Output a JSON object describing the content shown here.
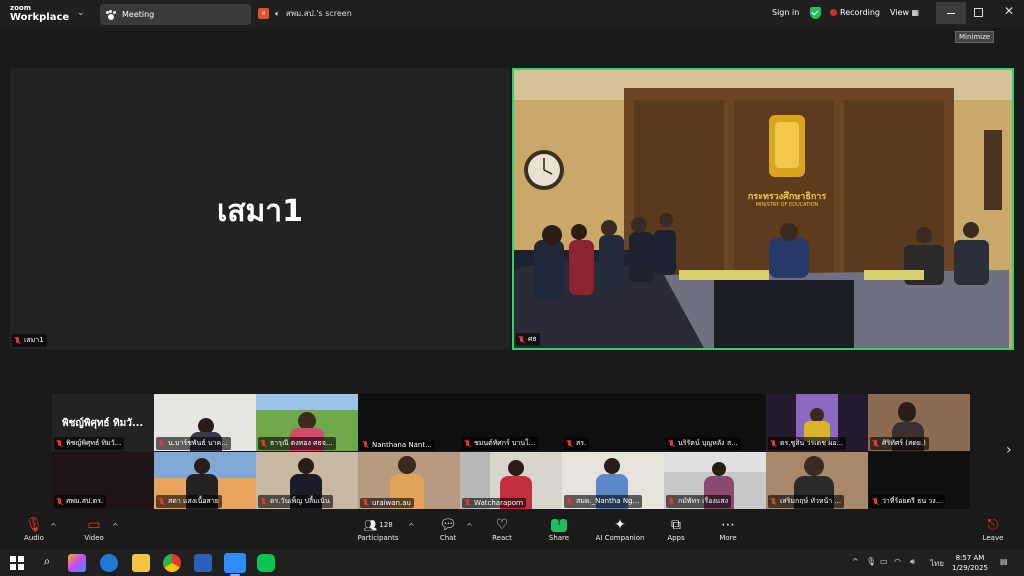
{
  "titlebar": {
    "brand_small": "zoom",
    "brand_large": "Workplace",
    "meeting_tab": "Meeting",
    "share_tab": "สพม.สป.'s screen",
    "share_badge": "ส",
    "signin": "Sign in",
    "recording": "Recording",
    "view": "View ▦",
    "tooltip": "Minimize"
  },
  "main": {
    "left_tile_name": "เสมา1",
    "left_tile_label": "เสมา1",
    "right_tile_label": "ศธ",
    "room_sign_th": "กระทรวงศึกษาธิการ",
    "room_sign_en": "MINISTRY OF EDUCATION"
  },
  "thumbs_row1": [
    {
      "label": "พิชญ์พิศุทธ์ ทิมวั...",
      "big": "พิชญ์พิศุทธ์ ทิมวั...",
      "kind": "name"
    },
    {
      "label": "น.บาร์ชพันธ์ นาค...",
      "kind": "person"
    },
    {
      "label": "ธารุณี ตงทอง ศธจ...",
      "kind": "field"
    },
    {
      "label": "Nanthana Nant...",
      "kind": "dark"
    },
    {
      "label": "ชมนต์ทัศกร์ บานใ...",
      "kind": "dark"
    },
    {
      "label": "สร.",
      "kind": "dark"
    },
    {
      "label": "นริรัตน์ บุญหลัง ส...",
      "kind": "dark"
    },
    {
      "label": "ดร.ชูสิน วรเดช ผอ...",
      "kind": "purple"
    },
    {
      "label": "ศิริทัศร์ (สดย.)",
      "kind": "woman"
    }
  ],
  "thumbs_row2": [
    {
      "label": "สพม.สป.ตร.",
      "kind": "dark"
    },
    {
      "label": "สตา แสงเนื้อสาย",
      "kind": "sunset"
    },
    {
      "label": "ดร.วันเพ็ญ ปลื้มเนิน",
      "kind": "office"
    },
    {
      "label": "uraiwan.au",
      "kind": "woman2"
    },
    {
      "label": "Watcharaporn",
      "kind": "building"
    },
    {
      "label": "สมด._Nantha Ng...",
      "kind": "woman3"
    },
    {
      "label": "กมัพัทร เรื่องแสง",
      "kind": "office2"
    },
    {
      "label": "เสริมกฤษ์ หัวหน้า ...",
      "kind": "man"
    },
    {
      "label": "ว่าที่ร้อยตรี ธน วง...",
      "kind": "dark"
    }
  ],
  "toolbar": {
    "audio": "Audio",
    "video": "Video",
    "participants": "Participants",
    "participants_count": "128",
    "chat": "Chat",
    "react": "React",
    "share": "Share",
    "ai": "AI Companion",
    "apps": "Apps",
    "more": "More",
    "leave": "Leave"
  },
  "taskbar": {
    "time": "8:57 AM",
    "date": "1/29/2025",
    "lang": "ไทย"
  }
}
